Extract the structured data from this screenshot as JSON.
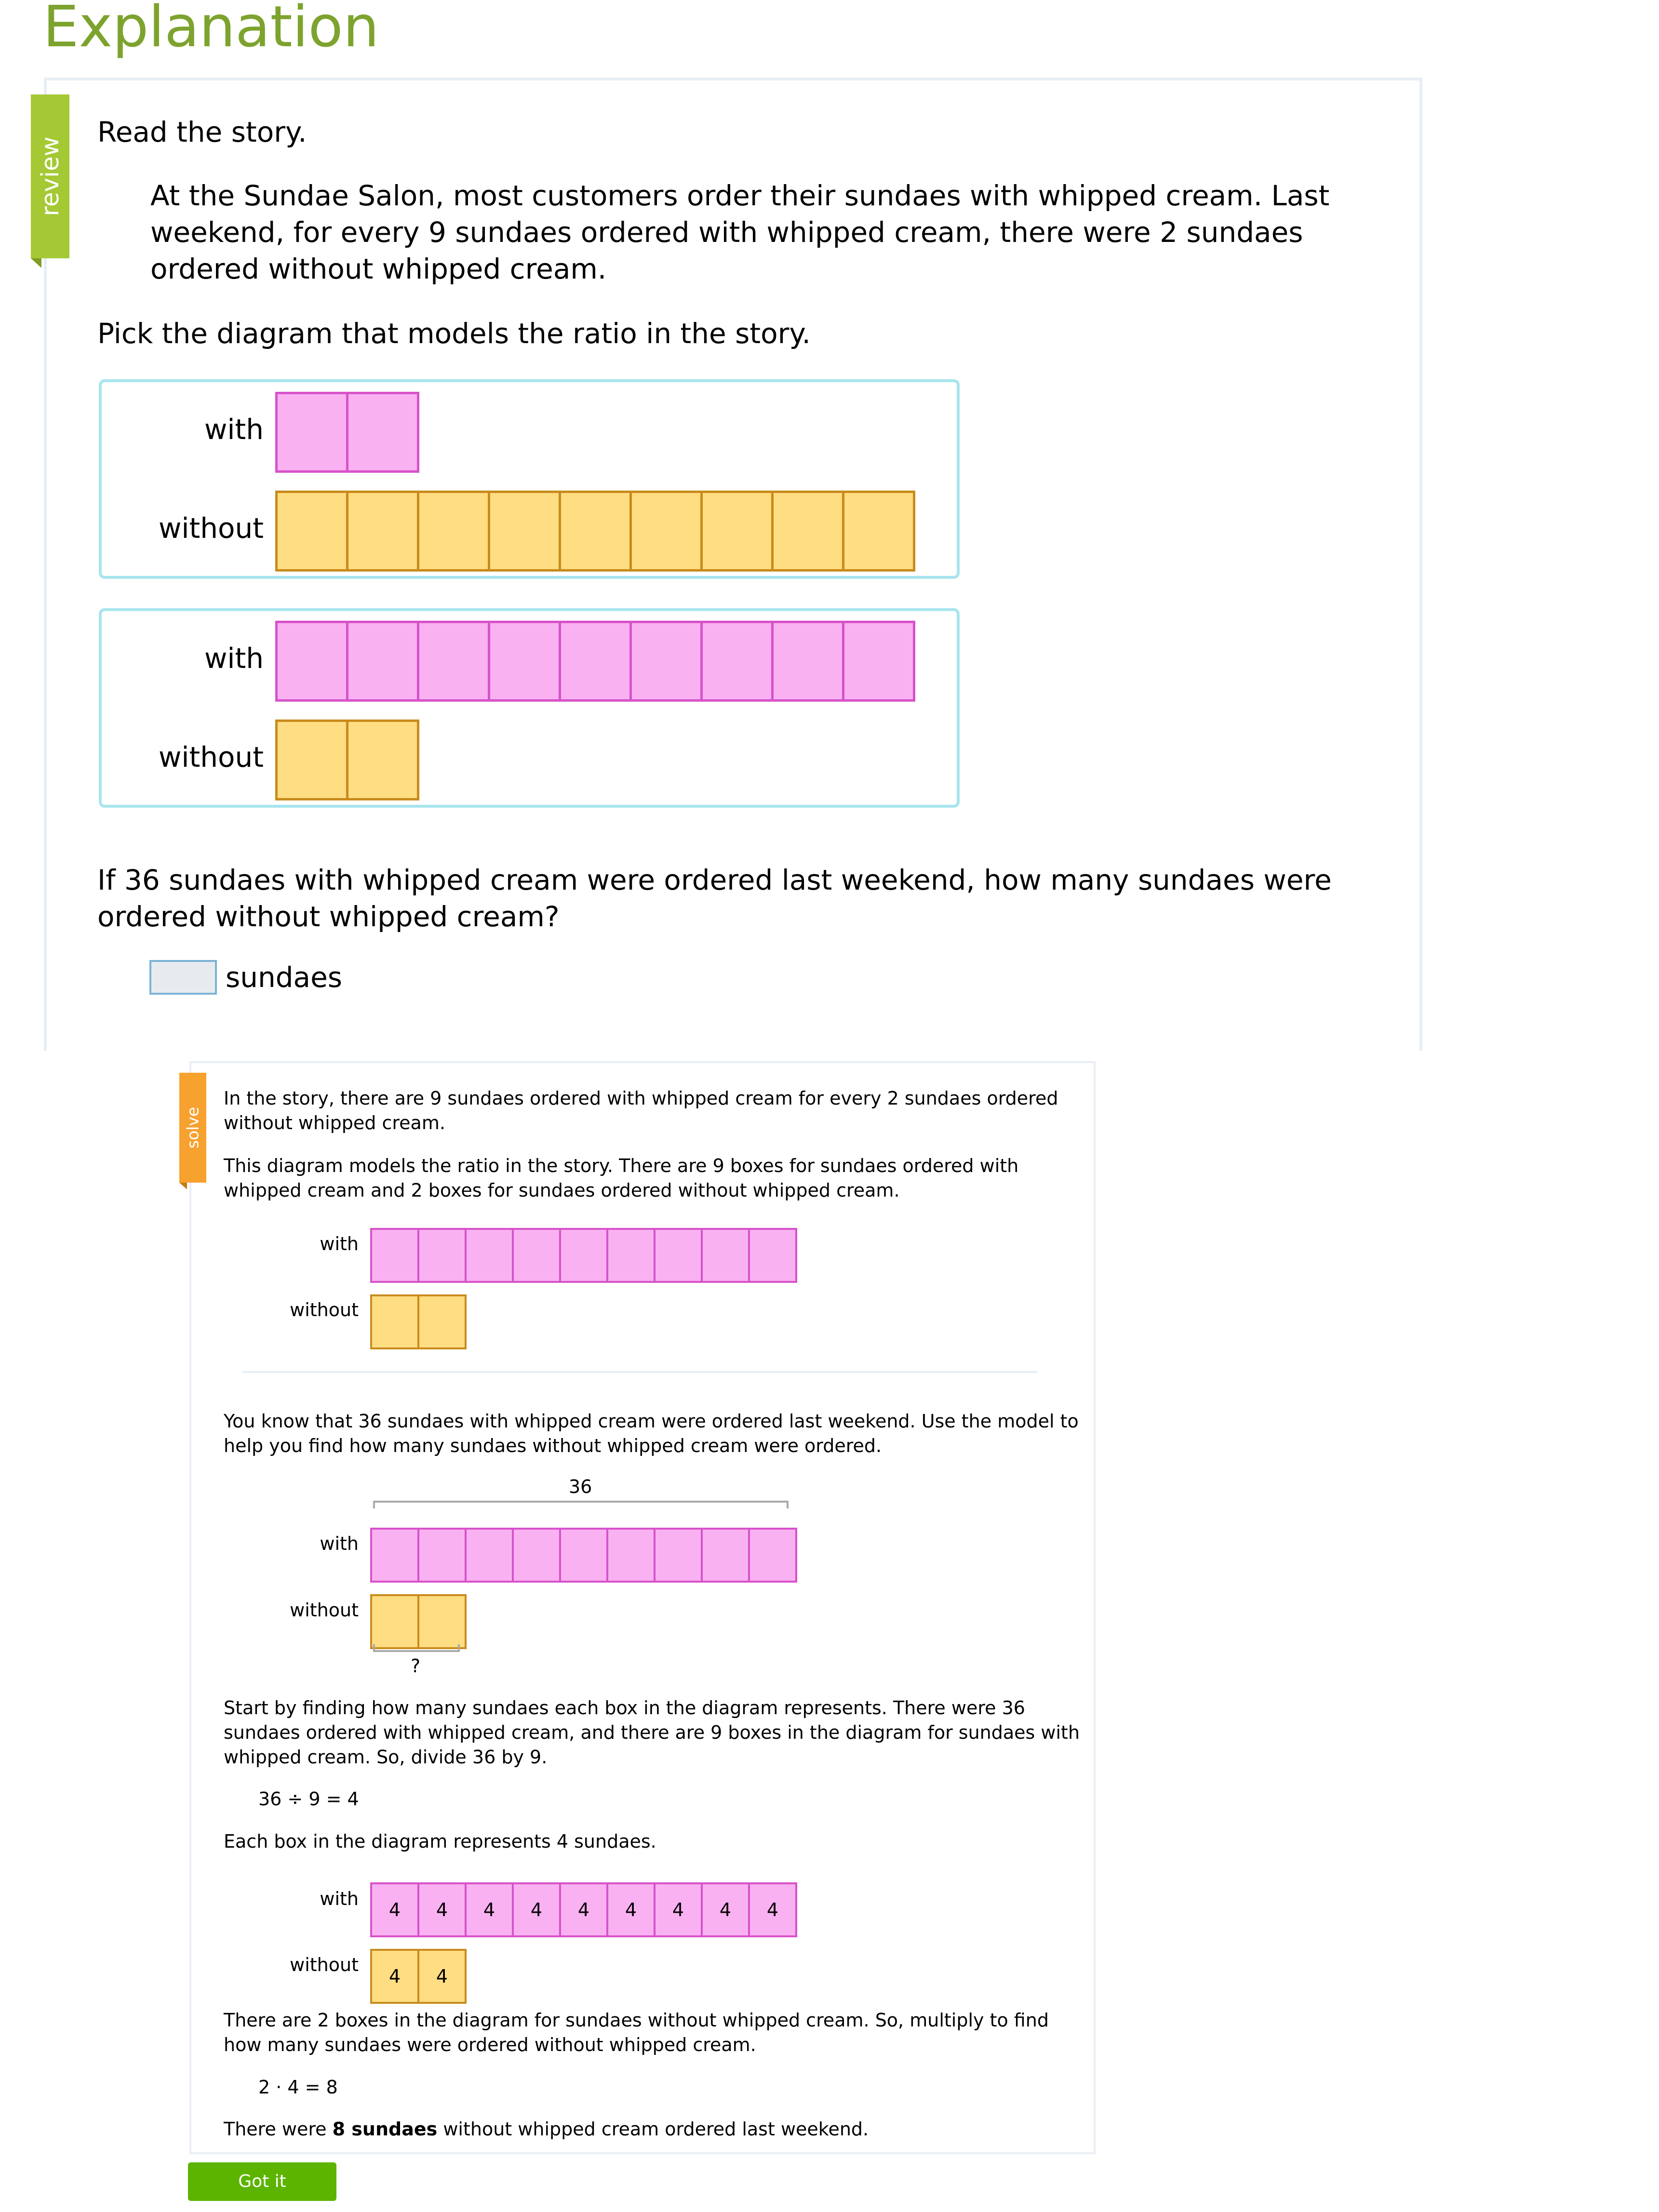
{
  "header": {
    "title": "Explanation"
  },
  "review": {
    "tag": "review",
    "instruction1": "Read the story.",
    "story": [
      "At the Sundae Salon, most customers order their sundaes with whipped cream. Last",
      "weekend, for every 9 sundaes ordered with whipped cream, there were 2 sundaes",
      "ordered without whipped cream."
    ],
    "instruction2": "Pick the diagram that models the ratio in the story.",
    "options": [
      {
        "with_label": "with",
        "without_label": "without",
        "with_count": 2,
        "without_count": 9
      },
      {
        "with_label": "with",
        "without_label": "without",
        "with_count": 9,
        "without_count": 2
      }
    ],
    "question": [
      "If 36 sundaes with whipped cream were ordered last weekend, how many sundaes were",
      "ordered without whipped cream?"
    ],
    "answer": {
      "value": "",
      "unit": "sundaes"
    }
  },
  "solve": {
    "tag": "solve",
    "p1": [
      "In the story, there are 9 sundaes ordered with whipped cream for every 2 sundaes ordered",
      "without whipped cream."
    ],
    "p2": [
      "This diagram models the ratio in the story. There are 9 boxes for sundaes ordered with",
      "whipped cream and 2 boxes for sundaes ordered without whipped cream."
    ],
    "p3": [
      "You know that 36 sundaes with whipped cream were ordered last weekend. Use the model to",
      "help you find how many sundaes without whipped cream were ordered."
    ],
    "total_label": "36",
    "unknown_label": "?",
    "p4": [
      "Start by finding how many sundaes each box in the diagram represents. There were 36",
      "sundaes ordered with whipped cream, and there are 9 boxes in the diagram for sundaes with",
      "whipped cream. So, divide 36 by 9."
    ],
    "eq1": "36 ÷ 9 = 4",
    "p5": "Each box in the diagram represents 4 sundaes.",
    "box_value": "4",
    "p6": [
      "There are 2 boxes in the diagram for sundaes without whipped cream. So, multiply to find",
      "how many sundaes were ordered without whipped cream."
    ],
    "eq2": "2 · 4 = 8",
    "final": {
      "pre": "There were ",
      "bold": "8 sundaes",
      "post": " without whipped cream ordered last weekend."
    },
    "labels": {
      "with": "with",
      "without": "without"
    },
    "diagrams": {
      "with_count": 9,
      "without_count": 2
    }
  },
  "buttons": {
    "got_it": "Got it"
  },
  "colors": {
    "title_green": "#7da32e",
    "review_tag": "#a4c934",
    "solve_tag": "#f7a12f",
    "pink_fill": "#f9b1f2",
    "pink_border": "#d752c9",
    "yellow_fill": "#ffdd82",
    "yellow_border": "#c88b1c",
    "option_border": "#a8e5ee",
    "button_green": "#5cb400"
  }
}
